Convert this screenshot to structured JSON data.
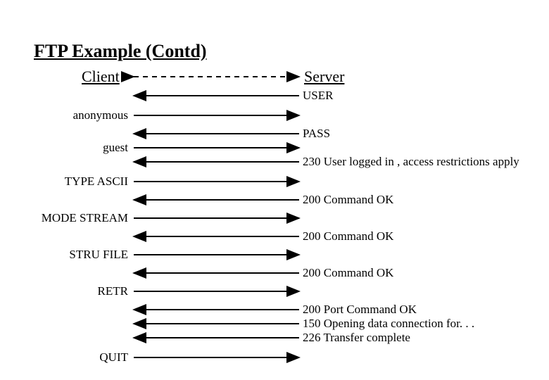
{
  "title": "FTP Example (Contd)",
  "headers": {
    "client": "Client",
    "server": "Server"
  },
  "messages": {
    "user": "USER",
    "anonymous": "anonymous",
    "pass": "PASS",
    "guest": "guest",
    "m230": "230 User logged in , access restrictions apply",
    "type_ascii": "TYPE ASCII",
    "ok1": "200 Command OK",
    "mode_stream": "MODE STREAM",
    "ok2": "200 Command OK",
    "stru_file": "STRU FILE",
    "ok3": "200 Command OK",
    "retr": "RETR",
    "port_ok": "200 Port Command OK",
    "opening": "150 Opening data connection for. . .",
    "transfer": "226 Transfer complete",
    "quit": "QUIT"
  }
}
